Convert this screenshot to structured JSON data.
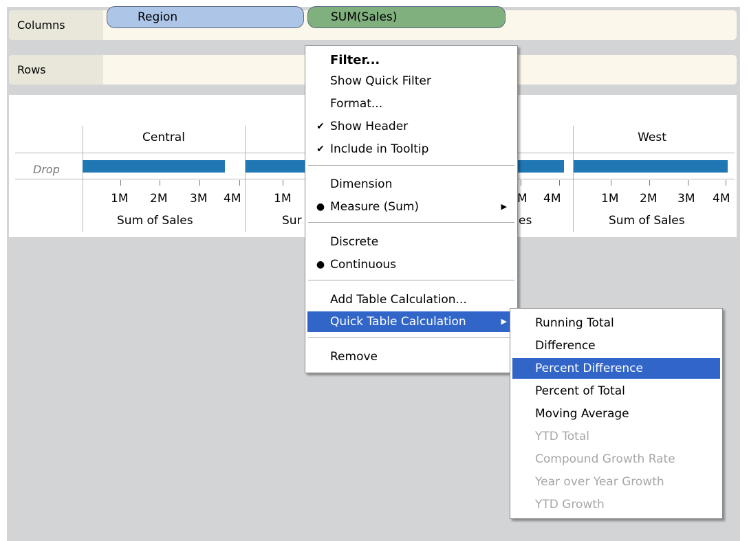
{
  "shelves": {
    "columns_label": "Columns",
    "rows_label": "Rows",
    "columns_pills": [
      {
        "label": "Region",
        "color": "#adc6e8"
      },
      {
        "label": "SUM(Sales)",
        "color": "#7fb07e"
      }
    ]
  },
  "view": {
    "drop_text": "Drop",
    "panes": [
      {
        "header": "Central",
        "value_m": 3.6,
        "ticks": [
          "1M",
          "2M",
          "3M",
          "4M"
        ],
        "axis_label": "Sum of Sales"
      },
      {
        "header": "",
        "value_m": null,
        "ticks": [
          "1M"
        ],
        "axis_label": "Sur"
      },
      {
        "header": "",
        "value_m": null,
        "ticks": [
          "M",
          "4M"
        ],
        "axis_label": "es"
      },
      {
        "header": "West",
        "value_m": 3.9,
        "ticks": [
          "1M",
          "2M",
          "3M",
          "4M"
        ],
        "axis_label": "Sum of Sales"
      }
    ],
    "bar_color": "#1f77b4"
  },
  "context_menu": {
    "items": {
      "filter": "Filter...",
      "show_quick_filter": "Show Quick Filter",
      "format": "Format...",
      "show_header": "Show Header",
      "include_in_tooltip": "Include in Tooltip",
      "dimension": "Dimension",
      "measure": "Measure (Sum)",
      "discrete": "Discrete",
      "continuous": "Continuous",
      "add_table_calc": "Add Table Calculation...",
      "quick_table_calc": "Quick Table Calculation",
      "remove": "Remove"
    },
    "marks": {
      "check": "✔",
      "dot": "●",
      "arrow": "▶"
    }
  },
  "submenu": {
    "items": [
      {
        "label": "Running Total",
        "enabled": true,
        "highlighted": false
      },
      {
        "label": "Difference",
        "enabled": true,
        "highlighted": false
      },
      {
        "label": "Percent Difference",
        "enabled": true,
        "highlighted": true
      },
      {
        "label": "Percent of Total",
        "enabled": true,
        "highlighted": false
      },
      {
        "label": "Moving Average",
        "enabled": true,
        "highlighted": false
      },
      {
        "label": "YTD Total",
        "enabled": false,
        "highlighted": false
      },
      {
        "label": "Compound Growth Rate",
        "enabled": false,
        "highlighted": false
      },
      {
        "label": "Year over Year Growth",
        "enabled": false,
        "highlighted": false
      },
      {
        "label": "YTD Growth",
        "enabled": false,
        "highlighted": false
      }
    ]
  },
  "colors": {
    "highlight": "#3166c8",
    "disabled_text": "#a7a7a7"
  }
}
